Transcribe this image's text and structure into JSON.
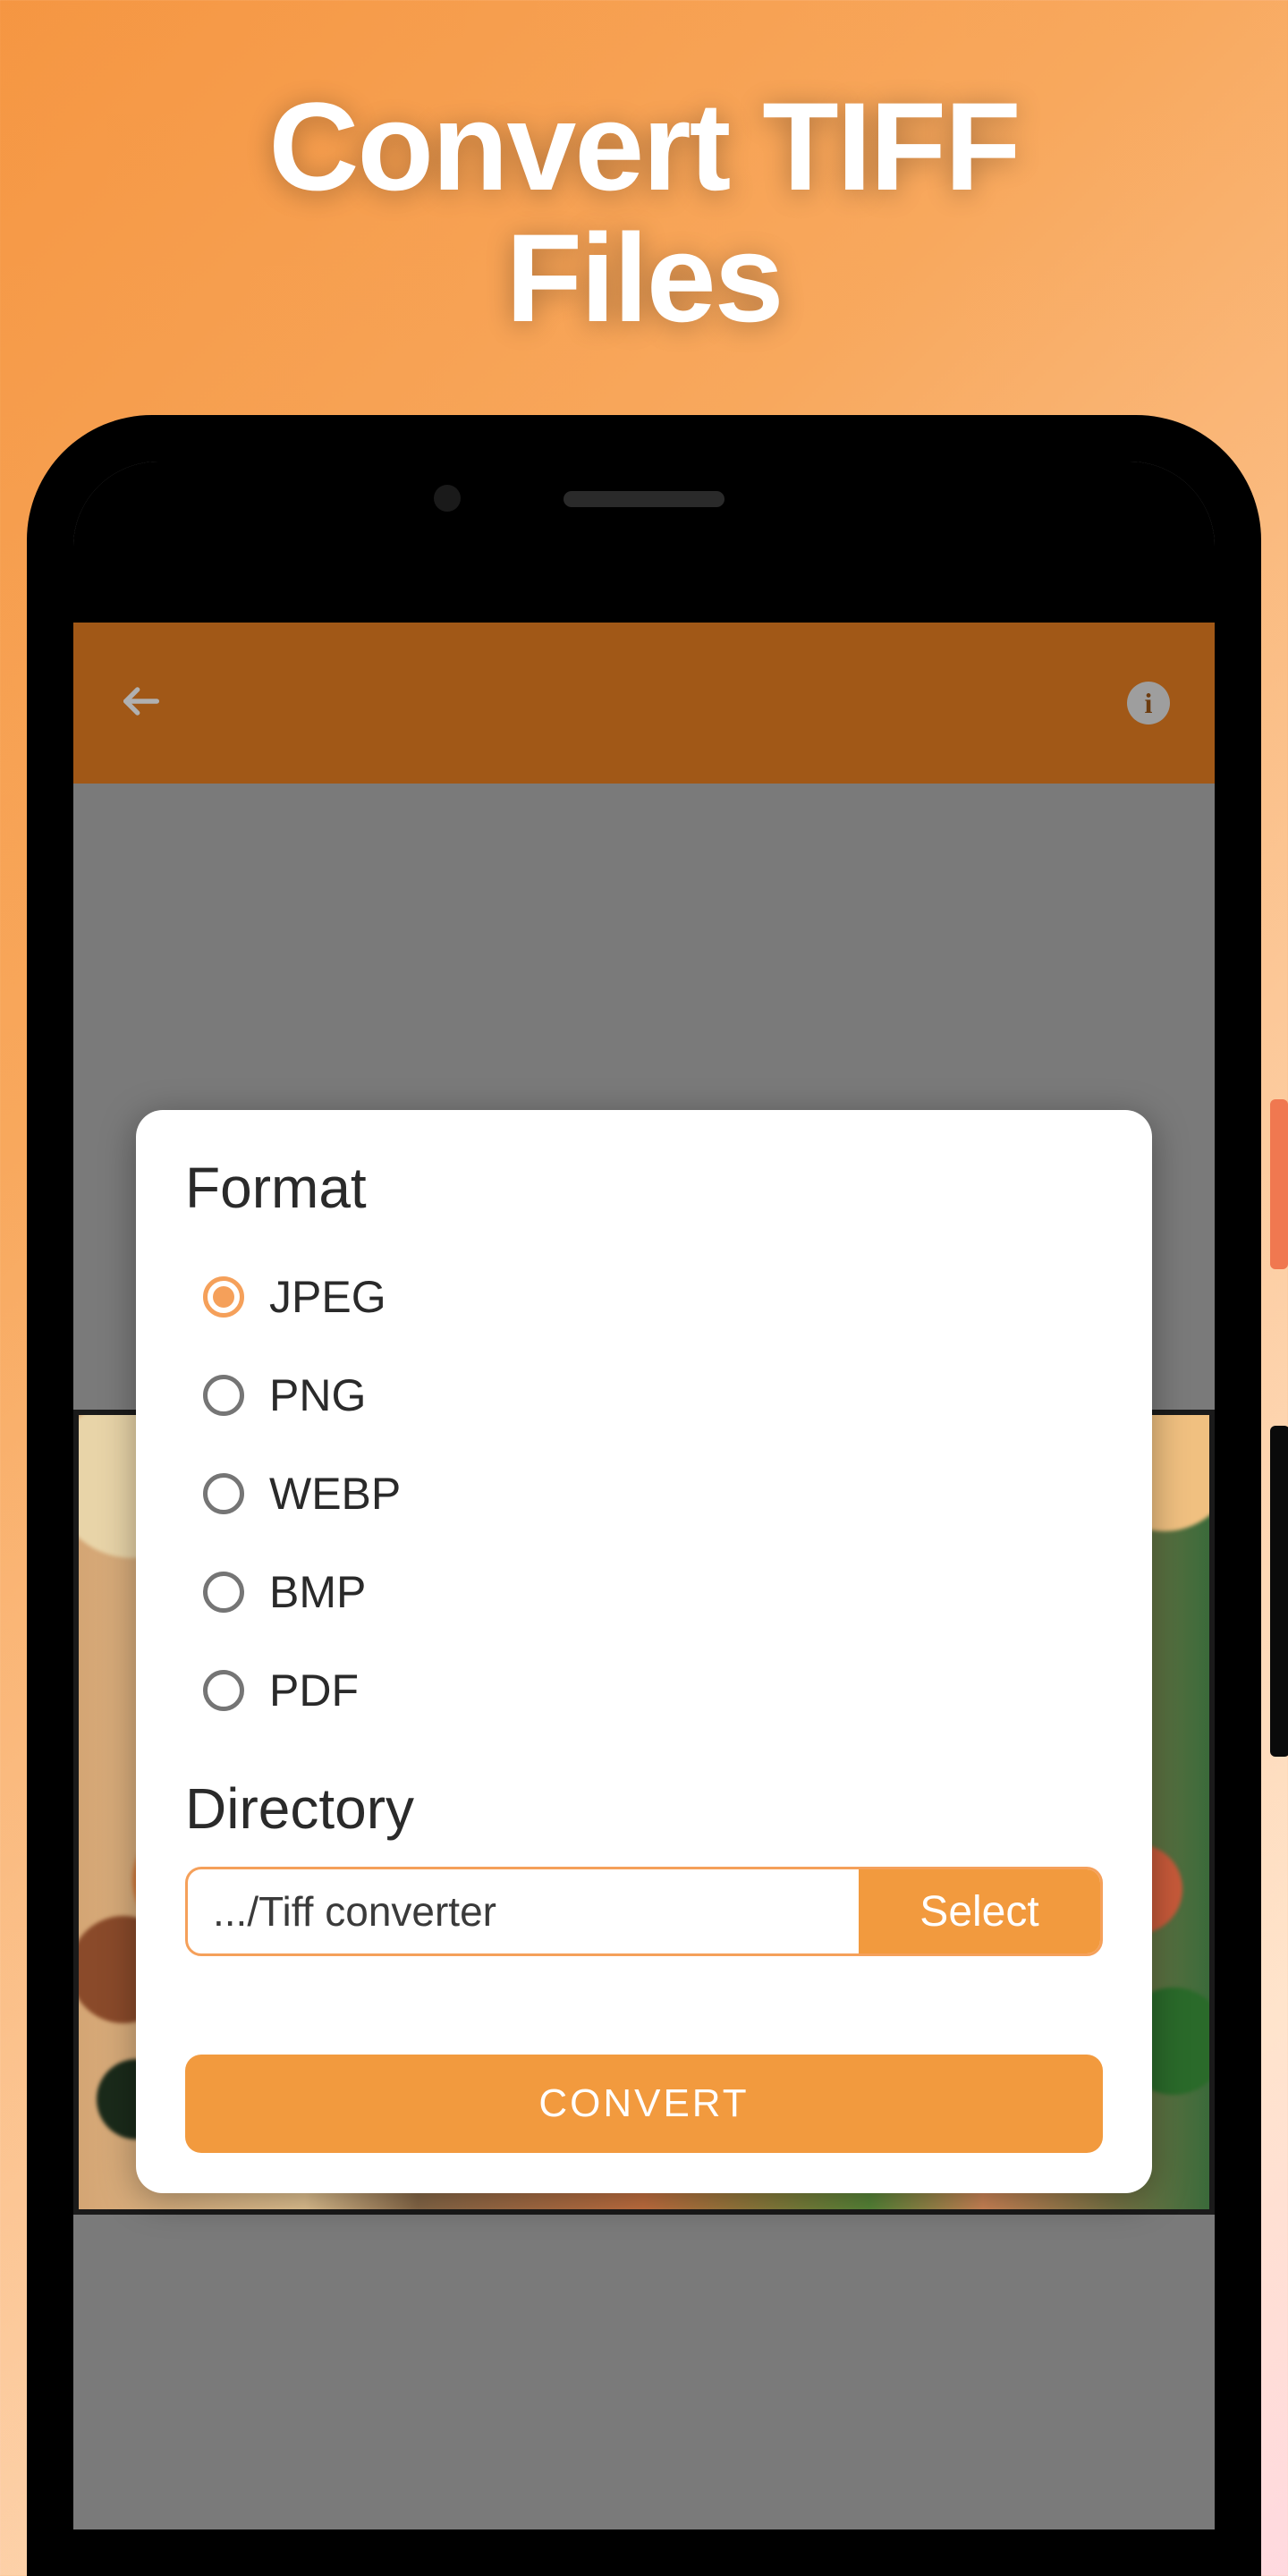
{
  "promo": {
    "title_line1": "Convert TIFF",
    "title_line2": "Files"
  },
  "appbar": {
    "back": "back",
    "info": "i"
  },
  "dialog": {
    "format_title": "Format",
    "formats": [
      {
        "label": "JPEG",
        "checked": true
      },
      {
        "label": "PNG",
        "checked": false
      },
      {
        "label": "WEBP",
        "checked": false
      },
      {
        "label": "BMP",
        "checked": false
      },
      {
        "label": "PDF",
        "checked": false
      }
    ],
    "directory_title": "Directory",
    "directory_path": ".../Tiff converter",
    "select_label": "Select",
    "convert_label": "CONVERT"
  }
}
